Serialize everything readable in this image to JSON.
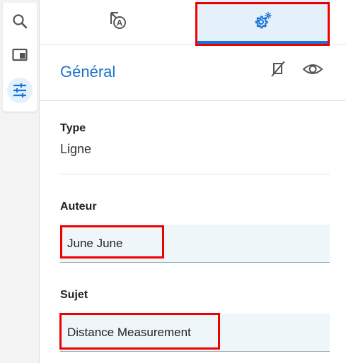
{
  "left_toolbar": {
    "items": [
      {
        "icon": "search-icon"
      },
      {
        "icon": "panel-icon"
      },
      {
        "icon": "sliders-icon",
        "active": true
      }
    ]
  },
  "tabs": [
    {
      "icon": "annotation-icon"
    },
    {
      "icon": "settings-gear-icon",
      "active": true
    }
  ],
  "section": {
    "title": "Général",
    "actions": [
      {
        "icon": "hide-off-icon"
      },
      {
        "icon": "eye-icon"
      }
    ]
  },
  "fields": {
    "type": {
      "label": "Type",
      "value": "Ligne"
    },
    "author": {
      "label": "Auteur",
      "value": "June June"
    },
    "subject": {
      "label": "Sujet",
      "value": "Distance Measurement"
    }
  },
  "colors": {
    "accent": "#1a73d9",
    "title_blue": "#1a73c9",
    "active_bg": "#e4f1fb",
    "highlight_red": "#ee0000",
    "input_bg": "#eff6fa"
  }
}
